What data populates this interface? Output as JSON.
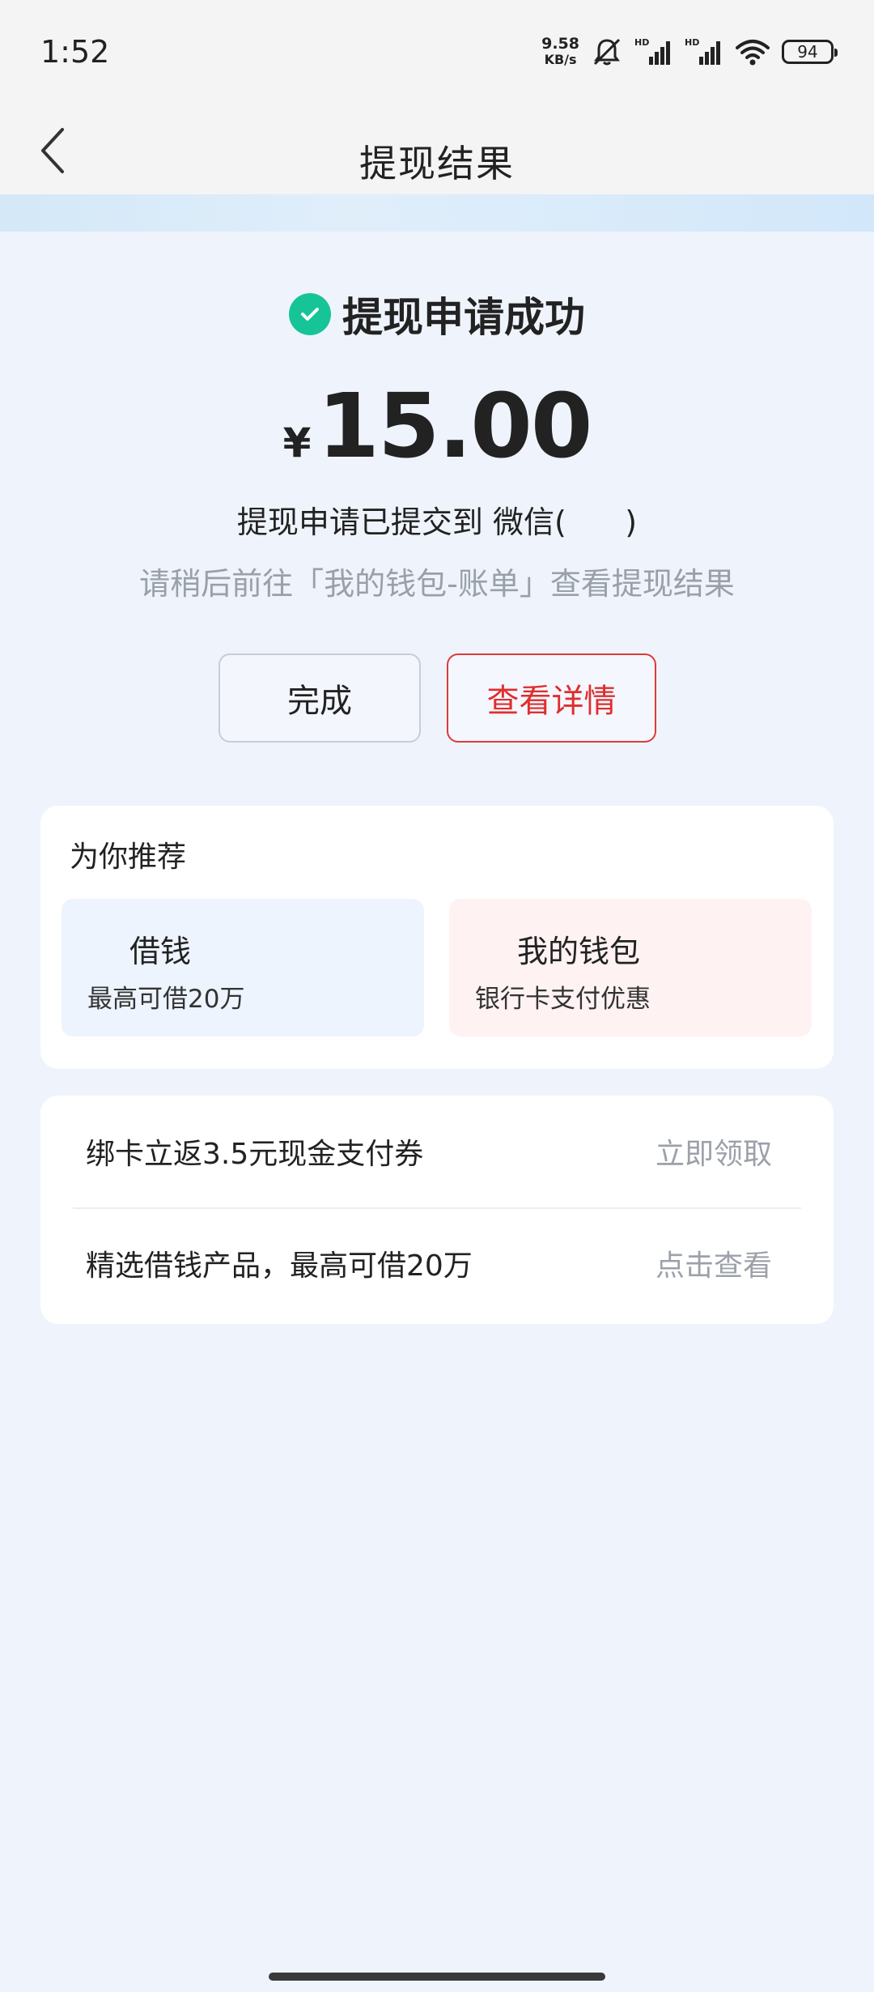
{
  "status_bar": {
    "time": "1:52",
    "net_speed_value": "9.58",
    "net_speed_unit": "KB/s",
    "signal_label_1": "HD",
    "signal_label_2": "HD",
    "battery": "94"
  },
  "nav": {
    "title": "提现结果"
  },
  "result": {
    "status_text": "提现申请成功",
    "currency": "¥",
    "amount": "15.00",
    "submitted_text": "提现申请已提交到 微信(      )",
    "hint_text": "请稍后前往「我的钱包-账单」查看提现结果",
    "done_label": "完成",
    "detail_label": "查看详情"
  },
  "recommend": {
    "title": "为你推荐",
    "tiles": [
      {
        "title": "借钱",
        "subtitle": "最高可借20万"
      },
      {
        "title": "我的钱包",
        "subtitle": "银行卡支付优惠"
      }
    ]
  },
  "offers": [
    {
      "text": "绑卡立返3.5元现金支付券",
      "action": "立即领取"
    },
    {
      "text": "精选借钱产品，最高可借20万",
      "action": "点击查看"
    }
  ],
  "colors": {
    "success_green": "#16c497",
    "accent_red": "#e02e2e",
    "page_bg": "#eff4fc"
  }
}
